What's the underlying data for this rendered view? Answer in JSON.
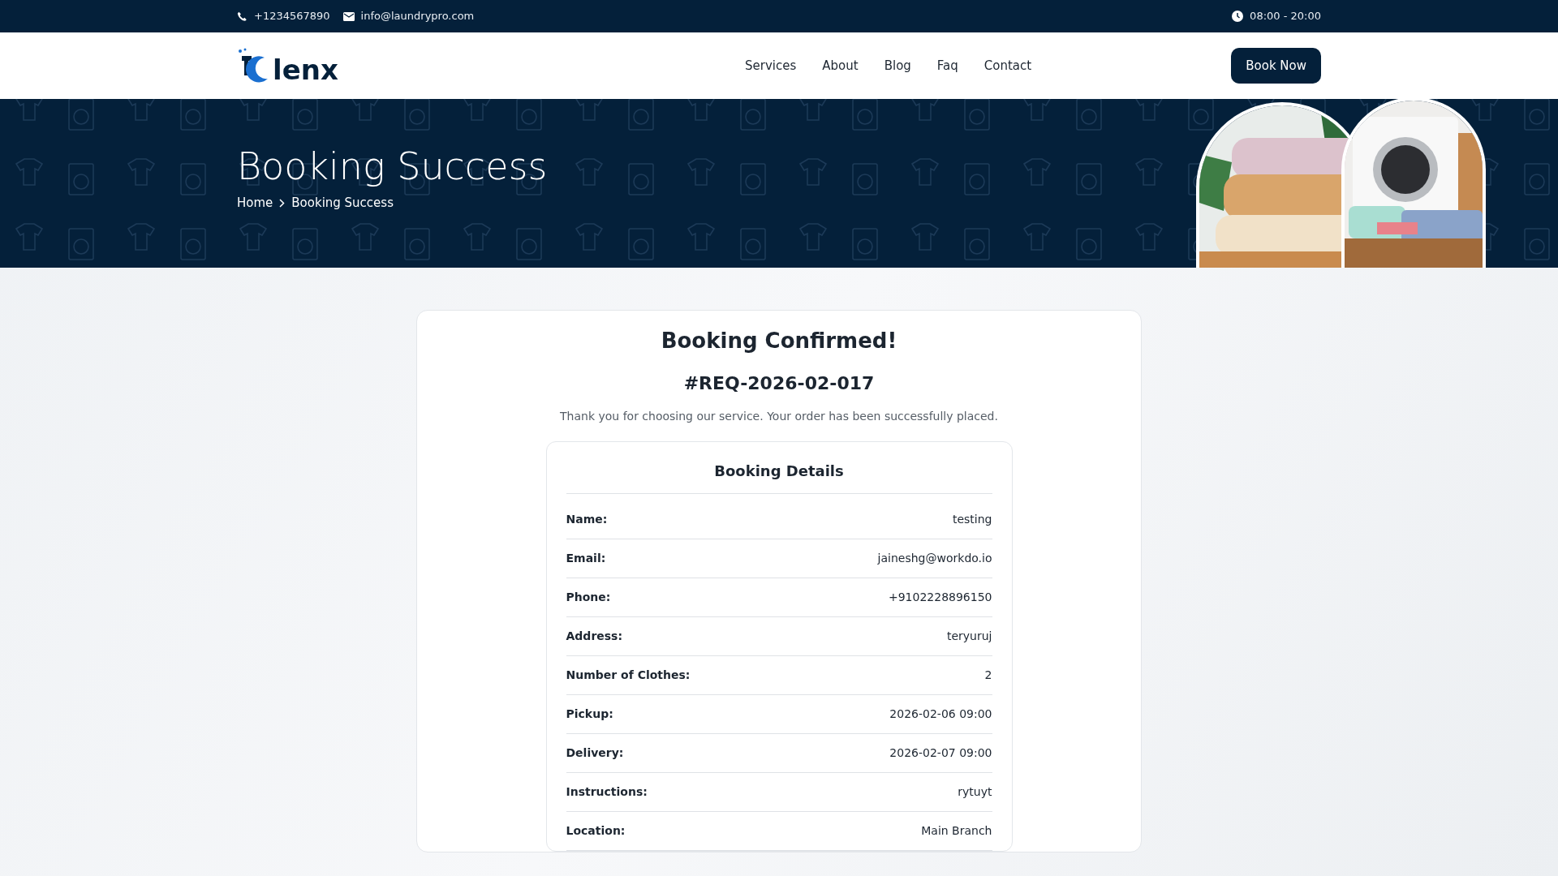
{
  "topbar": {
    "phone": "+1234567890",
    "email": "info@laundrypro.com",
    "hours": "08:00 - 20:00"
  },
  "navbar": {
    "logo_text": "lenx",
    "links": [
      "Services",
      "About",
      "Blog",
      "Faq",
      "Contact"
    ],
    "cta": "Book Now"
  },
  "hero": {
    "title": "Booking Success",
    "breadcrumb": [
      "Home",
      "Booking Success"
    ]
  },
  "confirmation": {
    "heading": "Booking Confirmed!",
    "reference": "#REQ-2026-02-017",
    "message": "Thank you for choosing our service. Your order has been successfully placed.",
    "details": {
      "title": "Booking Details",
      "rows": [
        {
          "label": "Name:",
          "value": "testing"
        },
        {
          "label": "Email:",
          "value": "jaineshg@workdo.io"
        },
        {
          "label": "Phone:",
          "value": "+9102228896150"
        },
        {
          "label": "Address:",
          "value": "teryuruj"
        },
        {
          "label": "Number of Clothes:",
          "value": "2"
        },
        {
          "label": "Pickup:",
          "value": "2026-02-06 09:00"
        },
        {
          "label": "Delivery:",
          "value": "2026-02-07 09:00"
        },
        {
          "label": "Instructions:",
          "value": "rytuyt"
        },
        {
          "label": "Location:",
          "value": "Main Branch"
        }
      ]
    }
  }
}
